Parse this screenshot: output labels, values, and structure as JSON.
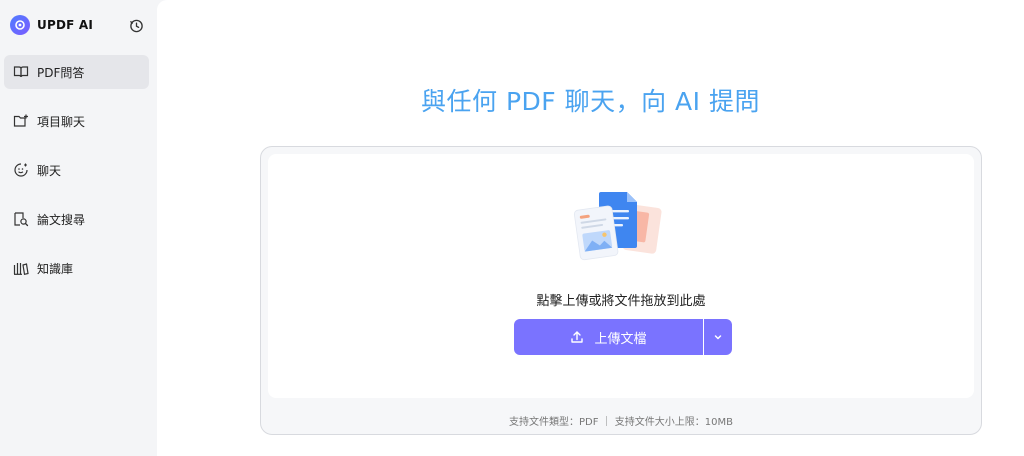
{
  "brand": {
    "name": "UPDF AI",
    "icon": "updf-logo-icon"
  },
  "header": {
    "history_icon": "history-icon"
  },
  "sidebar": {
    "items": [
      {
        "label": "PDF問答",
        "icon": "book-open-icon",
        "active": true
      },
      {
        "label": "項目聊天",
        "icon": "folder-plus-icon",
        "active": false
      },
      {
        "label": "聊天",
        "icon": "chat-smile-icon",
        "active": false
      },
      {
        "label": "論文搜尋",
        "icon": "document-search-icon",
        "active": false
      },
      {
        "label": "知識庫",
        "icon": "library-icon",
        "active": false
      }
    ]
  },
  "main": {
    "title": "與任何 PDF 聊天，向 AI 提問",
    "drop_text": "點擊上傳或將文件拖放到此處",
    "upload_button": "上傳文檔",
    "footer_note": "支持文件類型：PDF ｜ 支持文件大小上限：10MB"
  },
  "colors": {
    "accent": "#7a73ff",
    "title": "#4aa3f0",
    "sidebar_active": "#e5e6ea"
  }
}
